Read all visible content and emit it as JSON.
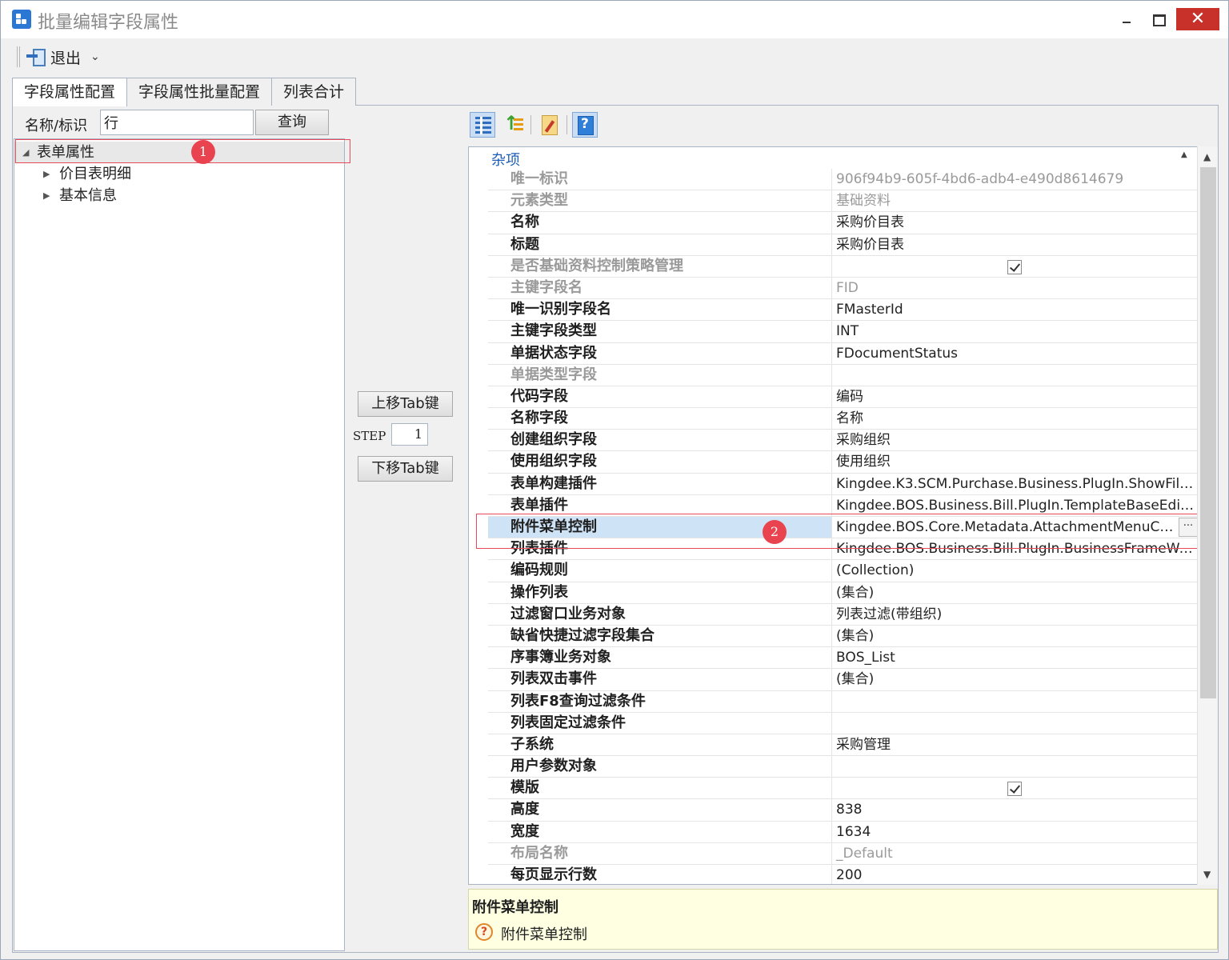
{
  "window": {
    "title": "批量编辑字段属性",
    "min_glyph": "",
    "max_glyph": "",
    "close_glyph": "✕"
  },
  "toolbar": {
    "exit_label": "退出",
    "chevron": "⌄"
  },
  "tabs": [
    {
      "label": "字段属性配置",
      "active": true
    },
    {
      "label": "字段属性批量配置",
      "active": false
    },
    {
      "label": "列表合计",
      "active": false
    }
  ],
  "search": {
    "label": "名称/标识",
    "value": "行",
    "button": "查询"
  },
  "tree": {
    "root": {
      "label": "表单属性",
      "arrow": "◢"
    },
    "children": [
      {
        "label": "价目表明细",
        "arrow": "▶"
      },
      {
        "label": "基本信息",
        "arrow": "▶"
      }
    ]
  },
  "markers": {
    "one": "1",
    "two": "2"
  },
  "mid_controls": {
    "move_up": "上移Tab键",
    "step_label": "STEP",
    "step_value": "1",
    "move_down": "下移Tab键"
  },
  "property_grid": {
    "category": "杂项",
    "collapse_glyph": "▲",
    "rows": [
      {
        "name": "唯一标识",
        "value": "906f94b9-605f-4bd6-adb4-e490d8614679",
        "dim": true
      },
      {
        "name": "元素类型",
        "value": "基础资料",
        "dim": true
      },
      {
        "name": "名称",
        "value": "采购价目表"
      },
      {
        "name": "标题",
        "value": "采购价目表"
      },
      {
        "name": "是否基础资料控制策略管理",
        "value": "",
        "dim": true,
        "checkbox": true
      },
      {
        "name": "主键字段名",
        "value": "FID",
        "dim": true
      },
      {
        "name": "唯一识别字段名",
        "value": "FMasterId"
      },
      {
        "name": "主键字段类型",
        "value": "INT"
      },
      {
        "name": "单据状态字段",
        "value": "FDocumentStatus"
      },
      {
        "name": "单据类型字段",
        "value": "",
        "dim": true
      },
      {
        "name": "代码字段",
        "value": "编码"
      },
      {
        "name": "名称字段",
        "value": "名称"
      },
      {
        "name": "创建组织字段",
        "value": "采购组织"
      },
      {
        "name": "使用组织字段",
        "value": "使用组织"
      },
      {
        "name": "表单构建插件",
        "value": "Kingdee.K3.SCM.Purchase.Business.PlugIn.ShowFilt..."
      },
      {
        "name": "表单插件",
        "value": "Kingdee.BOS.Business.Bill.PlugIn.TemplateBaseEdit, ..."
      },
      {
        "name": "附件菜单控制",
        "value": "Kingdee.BOS.Core.Metadata.AttachmentMenuCo...",
        "selected": true,
        "ellipsis": "···"
      },
      {
        "name": "列表插件",
        "value": "Kingdee.BOS.Business.Bill.PlugIn.BusinessFrameWor..."
      },
      {
        "name": "编码规则",
        "value": "(Collection)"
      },
      {
        "name": "操作列表",
        "value": "(集合)"
      },
      {
        "name": "过滤窗口业务对象",
        "value": "列表过滤(带组织)"
      },
      {
        "name": "缺省快捷过滤字段集合",
        "value": "(集合)"
      },
      {
        "name": "序事簿业务对象",
        "value": "BOS_List"
      },
      {
        "name": "列表双击事件",
        "value": "(集合)"
      },
      {
        "name": "列表F8查询过滤条件",
        "value": ""
      },
      {
        "name": "列表固定过滤条件",
        "value": ""
      },
      {
        "name": "子系统",
        "value": "采购管理"
      },
      {
        "name": "用户参数对象",
        "value": ""
      },
      {
        "name": "模版",
        "value": "",
        "checkbox": true
      },
      {
        "name": "高度",
        "value": "838"
      },
      {
        "name": "宽度",
        "value": "1634"
      },
      {
        "name": "布局名称",
        "value": "_Default",
        "dim": true
      },
      {
        "name": "每页显示行数",
        "value": "200"
      }
    ]
  },
  "scrollbar": {
    "up": "▲",
    "down": "▼"
  },
  "description": {
    "title": "附件菜单控制",
    "text": "附件菜单控制",
    "icon_glyph": "?"
  }
}
